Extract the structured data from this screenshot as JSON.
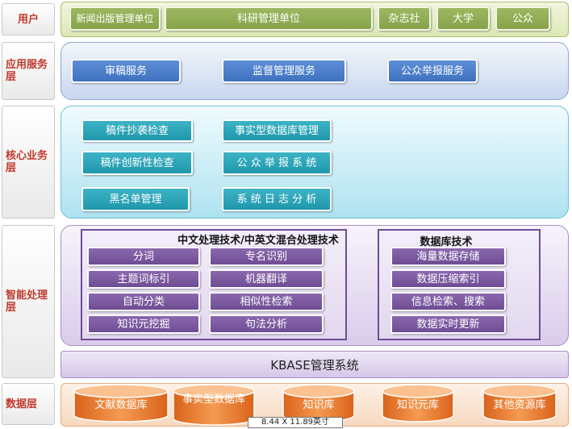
{
  "layers": [
    {
      "label": "用户"
    },
    {
      "label": "应用服务层"
    },
    {
      "label": "核心业务层"
    },
    {
      "label": "智能处理层"
    },
    {
      "label": "数据层"
    }
  ],
  "users": [
    "新闻出版管理单位",
    "科研管理单位",
    "杂志社",
    "大学",
    "公众"
  ],
  "app_services": [
    "审稿服务",
    "监督管理服务",
    "公众举报服务"
  ],
  "core_services": [
    "稿件抄袭检查",
    "事实型数据库管理",
    "稿件创新性检查",
    "公 众 举 报 系 统",
    "黑名单管理",
    "系 统 日 志 分 析"
  ],
  "nlp_group": {
    "title": "中文处理技术/中英文混合处理技术",
    "items": [
      "分词",
      "专名识别",
      "主题词标引",
      "机器翻译",
      "自动分类",
      "相似性检索",
      "知识元挖掘",
      "句法分析"
    ]
  },
  "db_group": {
    "title": "数据库技术",
    "items": [
      "海量数据存储",
      "数据压缩索引",
      "信息检索、搜索",
      "数据实时更新"
    ]
  },
  "kbase": "KBASE管理系统",
  "databases": [
    "文献数据库",
    "事实型数据库",
    "知识库",
    "知识元库",
    "其他资源库"
  ],
  "tooltip": "8.44 X 11.89英寸",
  "colors": {
    "accent_red": "#c0392b",
    "user_green": "#86a34a",
    "service_blue": "#3f72bf",
    "core_teal": "#1f97ab",
    "tech_purple": "#6e4d93",
    "db_orange": "#e8742a"
  }
}
